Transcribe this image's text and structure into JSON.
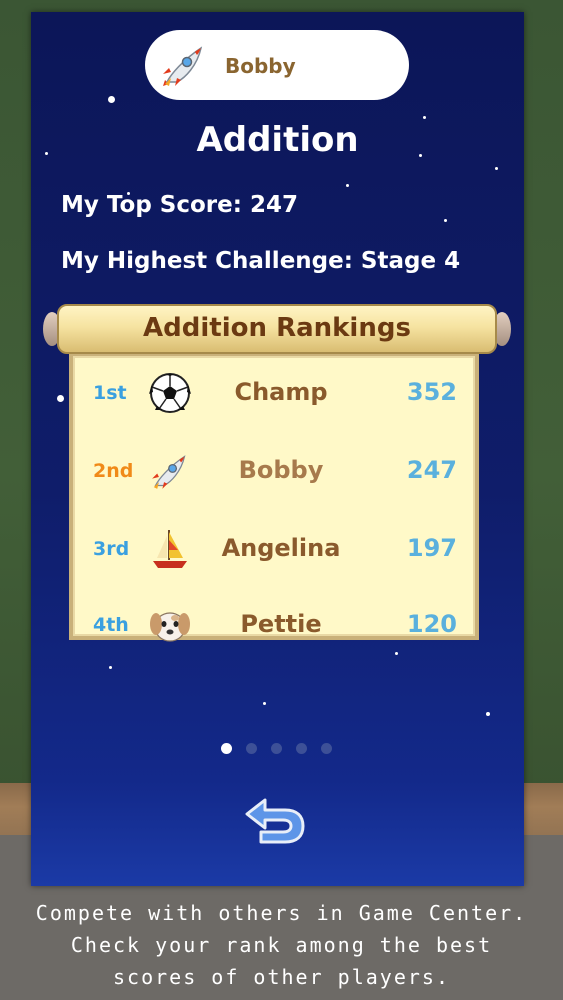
{
  "player": {
    "name": "Bobby",
    "icon": "rocket-icon"
  },
  "mode": {
    "title": "Addition",
    "top_score_text": "My Top Score: 247",
    "highest_challenge_text": "My Highest Challenge: Stage 4"
  },
  "rankings": {
    "title": "Addition Rankings",
    "rows": [
      {
        "rank": "1st",
        "icon": "soccer-ball-icon",
        "name": "Champ",
        "score": "352",
        "rank_color": "#3aa0e0"
      },
      {
        "rank": "2nd",
        "icon": "rocket-icon",
        "name": "Bobby",
        "score": "247",
        "rank_color": "#f08a18"
      },
      {
        "rank": "3rd",
        "icon": "sailboat-icon",
        "name": "Angelina",
        "score": "197",
        "rank_color": "#3aa0e0"
      },
      {
        "rank": "4th",
        "icon": "dog-icon",
        "name": "Pettie",
        "score": "120",
        "rank_color": "#3aa0e0"
      }
    ]
  },
  "pagination": {
    "total": 5,
    "current": 1
  },
  "back_button": {
    "icon": "back-arrow-icon"
  },
  "caption": {
    "line1": "Compete with others in Game Center.",
    "line2": "Check your rank among the best",
    "line3": "scores of other players."
  },
  "colors": {
    "panel": "#0f1d6a",
    "scroll": "#f6e3a1",
    "board": "#fff9c8",
    "name_brown": "#8a5a2c",
    "score_blue": "#5ab0dd"
  }
}
